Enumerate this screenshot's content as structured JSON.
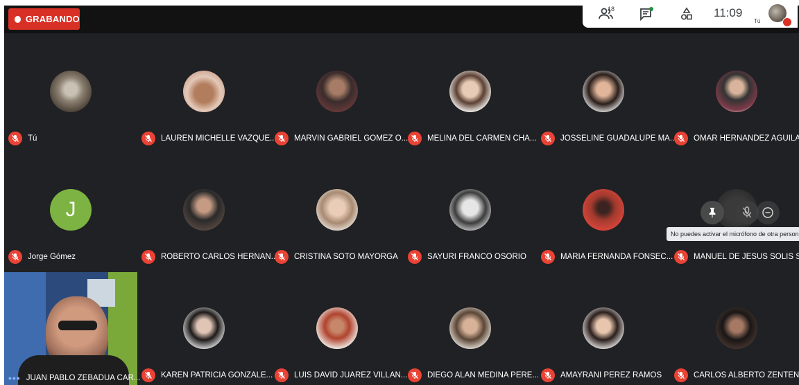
{
  "recording": {
    "label": "GRABANDO"
  },
  "top_panel": {
    "participant_count": "18",
    "time": "11:09",
    "self_label": "Tú"
  },
  "participants": [
    {
      "name": "Tú",
      "avatar": "photo-street"
    },
    {
      "name": "LAUREN MICHELLE VAZQUE...",
      "avatar": "photo-cartoon-mouse"
    },
    {
      "name": "MARVIN GABRIEL GOMEZ O...",
      "avatar": "photo-man-selfie"
    },
    {
      "name": "MELINA DEL CARMEN CHA...",
      "avatar": "photo-woman-glasses"
    },
    {
      "name": "JOSSELINE GUADALUPE MA...",
      "avatar": "photo-woman-smile"
    },
    {
      "name": "OMAR HERNANDEZ AGUILAR",
      "avatar": "photo-man-sweater"
    },
    {
      "name": "Jorge Gómez",
      "avatar": "letter",
      "initial": "J"
    },
    {
      "name": "ROBERTO CARLOS HERNAN...",
      "avatar": "photo-man-dark"
    },
    {
      "name": "CRISTINA SOTO MAYORGA",
      "avatar": "photo-woman-light"
    },
    {
      "name": "SAYURI FRANCO OSORIO",
      "avatar": "photo-woman-bw"
    },
    {
      "name": "MARIA FERNANDA FONSEC...",
      "avatar": "photo-woman-red"
    },
    {
      "name": "MANUEL DE JESUS SOLIS S...",
      "avatar": "photo-hidden"
    },
    {
      "name": "JUAN PABLO ZEBADUA CAR...",
      "avatar": "video"
    },
    {
      "name": "KAREN PATRICIA GONZALE...",
      "avatar": "photo-woman-dark"
    },
    {
      "name": "LUIS DAVID JUAREZ VILLAN...",
      "avatar": "photo-red-hair"
    },
    {
      "name": "DIEGO ALAN MEDINA PERE...",
      "avatar": "photo-young-man"
    },
    {
      "name": "AMAYRANI PEREZ RAMOS",
      "avatar": "photo-woman-white"
    },
    {
      "name": "CARLOS ALBERTO ZENTEN...",
      "avatar": "photo-man-glasses"
    }
  ],
  "tooltip": {
    "text": "No puedes activar el micrófono de otra persona"
  },
  "colors": {
    "background": "#202124",
    "muted_red": "#ea4335",
    "recording_red": "#d93025",
    "avatar_green": "#7cb342"
  }
}
